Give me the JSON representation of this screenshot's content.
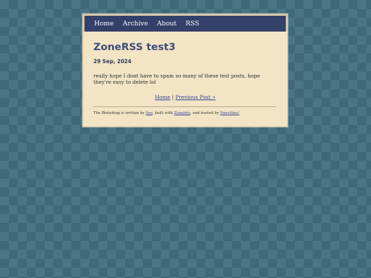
{
  "nav": {
    "items": [
      "Home",
      "Archive",
      "About",
      "RSS"
    ]
  },
  "post": {
    "title": "ZoneRSS test3",
    "date": "29 Sep, 2024",
    "body": "really hope I dont have to spam so many of these test posts, hope they're easy to delete lol"
  },
  "post_nav": {
    "home": "Home",
    "separator": "|",
    "previous": "Previous Post »"
  },
  "footer": {
    "prefix": "The Bintoblog is written by",
    "author": "Sye",
    "mid1": ", built with",
    "builder": "Zonelets",
    "mid2": ", and hosted by",
    "host": "Neocities!"
  }
}
